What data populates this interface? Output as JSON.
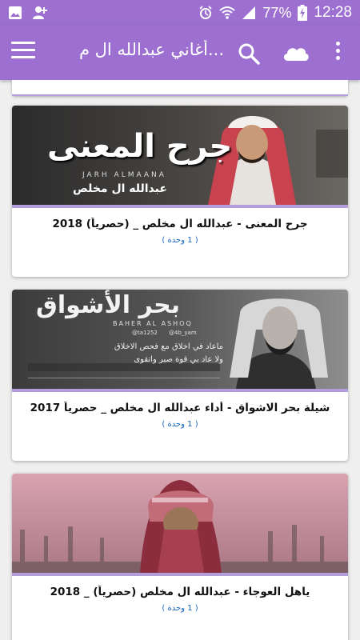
{
  "status_bar": {
    "battery_percent": "77%",
    "time": "12:28"
  },
  "app_bar": {
    "title": "أغاني عبدالله ال م..."
  },
  "cards": [
    {
      "title": "جرح المعنى - عبدالله ال مخلص _ (حصرياً) 2018",
      "count": "( 1 وحدة )",
      "thumb": {
        "headline": "جرح المعنى",
        "latin": "JARH ALMAANA",
        "artist": "عبدالله ال مخلص"
      }
    },
    {
      "title": "شيلة بحر الاشواق - أداء عبدالله ال مخلص _ حصرياً 2017",
      "count": "( 1 وحدة )",
      "thumb": {
        "headline": "بحر الأشواق",
        "latin": "BAHER AL ASHOQ",
        "handle1": "@ta1252",
        "handle2": "@4b_yam",
        "line1": "ماعاد في اخلاق مع فحص الاخلاق",
        "line2": "ولا عاد بي قوة صبر واتقوى"
      }
    },
    {
      "title": "ياهل العوجاء - عبدالله ال مخلص (حصرياً) _ 2018",
      "count": "( 1 وحدة )",
      "thumb": {}
    }
  ]
}
